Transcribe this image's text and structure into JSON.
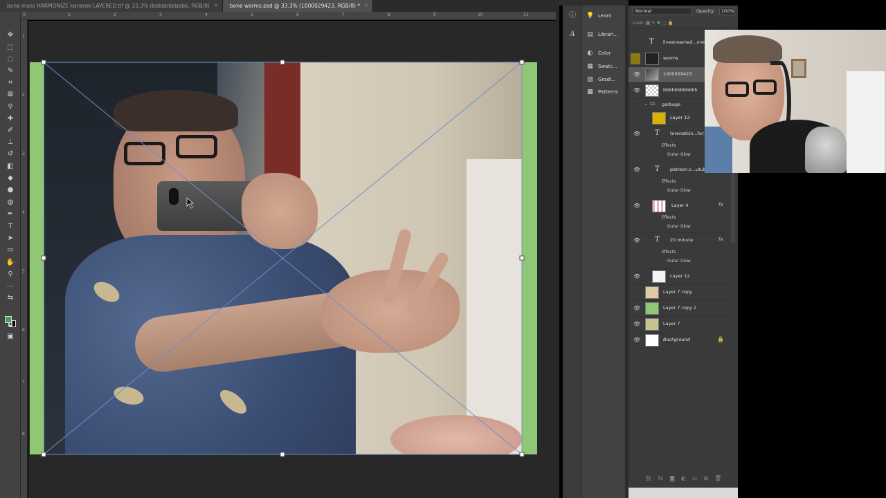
{
  "tabs": [
    {
      "label": "bone moss HARMONIZE kanarek LAYERED.tif @ 33.3% (bbbbbbbbbbb, RGB/8)",
      "active": false
    },
    {
      "label": "bone worms.psd @ 33.3% (1000029423, RGB/8) *",
      "active": true
    }
  ],
  "ruler": {
    "top": [
      "0",
      "1",
      "2",
      "3",
      "4",
      "5",
      "6",
      "7",
      "8",
      "9",
      "10",
      "11"
    ],
    "left": [
      "1",
      "2",
      "3",
      "4",
      "5",
      "6",
      "7",
      "8"
    ]
  },
  "right_mini_panel": {
    "items": [
      {
        "label": "Learn",
        "icon": "lightbulb-icon"
      },
      {
        "label": "Librari...",
        "icon": "library-icon"
      },
      {
        "label": "Color",
        "icon": "color-wheel-icon"
      },
      {
        "label": "Swatc...",
        "icon": "swatches-grid-icon"
      },
      {
        "label": "Gradi...",
        "icon": "gradient-icon"
      },
      {
        "label": "Patterns",
        "icon": "patterns-icon"
      }
    ]
  },
  "layers_panel": {
    "blend_mode": "Normal",
    "opacity_label": "Opacity:",
    "opacity_value": "100%",
    "lock_label": "Lock:",
    "layers": [
      {
        "name": "livestreamed...orena",
        "type": "text",
        "visible": false,
        "selected": false
      },
      {
        "name": "worms",
        "type": "image",
        "visible": false,
        "selected": false,
        "thumb": "#222222"
      },
      {
        "name": "1000029423",
        "type": "image",
        "visible": true,
        "selected": true,
        "thumb": "#6f7280"
      },
      {
        "name": "bbbbbbbbbbbb",
        "type": "image",
        "visible": true,
        "selected": false,
        "thumb": "#d8d8d8"
      },
      {
        "name": "garbage",
        "type": "group",
        "visible": false,
        "selected": false
      },
      {
        "name": "Layer 13",
        "type": "image",
        "visible": false,
        "selected": false,
        "thumb": "#d9b300"
      },
      {
        "name": "torenatkin...for-s",
        "type": "text",
        "visible": true,
        "selected": false,
        "effects": [
          "Effects",
          "Outer Glow"
        ]
      },
      {
        "name": "patreon.c...utubsu",
        "type": "text",
        "visible": true,
        "selected": false,
        "effects": [
          "Effects",
          "Outer Glow"
        ]
      },
      {
        "name": "Layer 4",
        "type": "image",
        "visible": true,
        "selected": false,
        "thumb": "#e8b0c0",
        "fx": true,
        "effects": [
          "Effects",
          "Outer Glow"
        ]
      },
      {
        "name": "20 minute",
        "type": "text",
        "visible": true,
        "selected": false,
        "fx": true,
        "effects": [
          "Effects",
          "Outer Glow"
        ]
      },
      {
        "name": "Layer 12",
        "type": "image",
        "visible": true,
        "selected": false,
        "thumb": "#f4f4f4"
      },
      {
        "name": "Layer 7 copy",
        "type": "image",
        "visible": false,
        "selected": false,
        "thumb": "#e2c9a6"
      },
      {
        "name": "Layer 7 copy 2",
        "type": "image",
        "visible": true,
        "selected": false,
        "thumb": "#8fc774"
      },
      {
        "name": "Layer 7",
        "type": "image",
        "visible": true,
        "selected": false,
        "thumb": "#c8c28e"
      },
      {
        "name": "Background",
        "type": "background",
        "visible": true,
        "selected": false,
        "thumb": "#ffffff",
        "locked": true
      }
    ]
  },
  "colors": {
    "foreground": "#3f9f5a",
    "background": "#000000",
    "document_green": "#8fc774",
    "transform_box": "#6d8fc7"
  }
}
